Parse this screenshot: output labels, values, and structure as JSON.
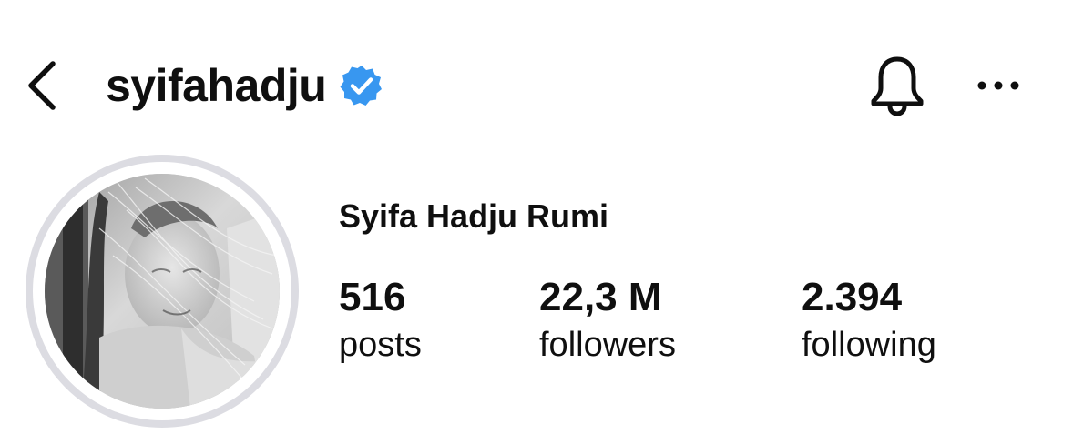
{
  "header": {
    "username": "syifahadju",
    "verified_icon": "verified-badge-icon",
    "back_icon": "chevron-left-icon",
    "bell_icon": "bell-icon",
    "more_icon": "more-horizontal-icon"
  },
  "profile": {
    "full_name": "Syifa Hadju Rumi",
    "avatar_icon": "profile-photo"
  },
  "stats": [
    {
      "value": "516",
      "label": "posts"
    },
    {
      "value": "22,3 M",
      "label": "followers"
    },
    {
      "value": "2.394",
      "label": "following"
    }
  ],
  "colors": {
    "verified_blue": "#3897f0",
    "text": "#0f0f0f",
    "ring": "#dcdce2"
  }
}
